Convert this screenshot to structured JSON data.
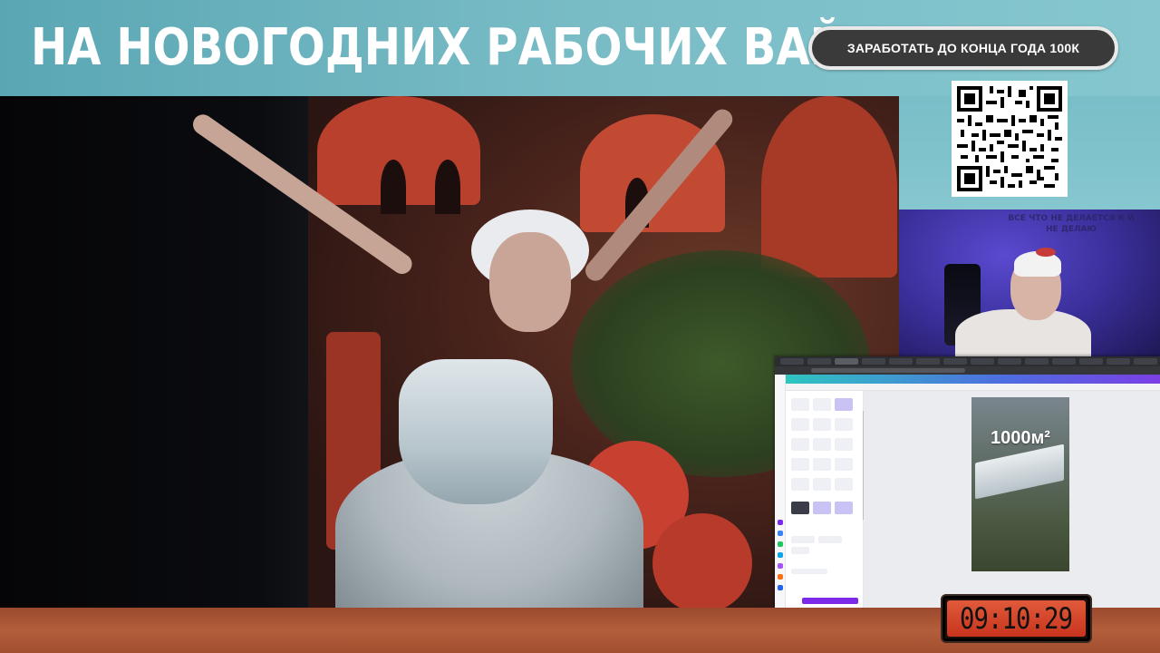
{
  "header": {
    "title": "НА НОВОГОДНИХ РАБОЧИХ ВАЙБАХ",
    "cta_label": "ЗАРАБОТАТЬ ДО КОНЦА ГОДА 100К"
  },
  "webcam": {
    "wall_text": "ВСЕ ЧТО НЕ ДЕЛАЕТСЯ К И НЕ ДЕЛАЮ"
  },
  "screen_share": {
    "design_title": "1000м²"
  },
  "timer": {
    "value": "09:10:29"
  },
  "colors": {
    "accent_teal": "#6fb7c2",
    "cta_bg": "#3a3a3a",
    "timer_bg": "#c8341e",
    "canva_purple": "#7d2ae8"
  },
  "icons": [
    "qr-code-icon"
  ]
}
